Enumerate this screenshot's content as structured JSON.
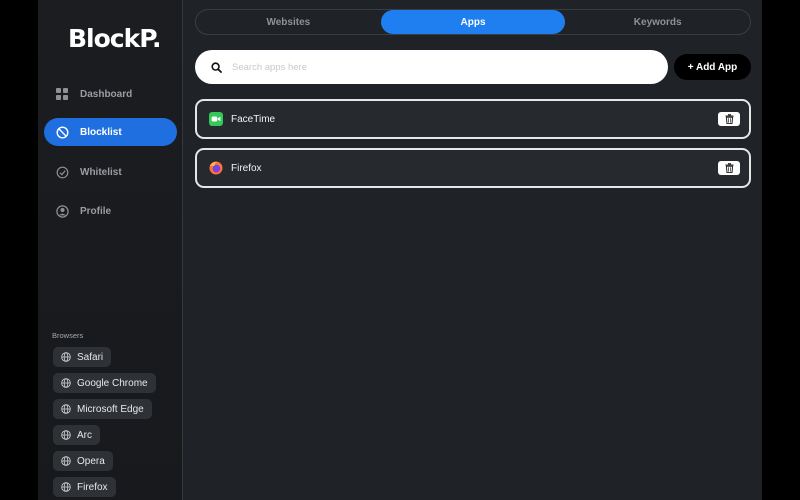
{
  "app": {
    "logo_text": "BlockP."
  },
  "sidebar": {
    "items": [
      {
        "label": "Dashboard",
        "icon": "grid-icon",
        "active": false
      },
      {
        "label": "Blocklist",
        "icon": "block-icon",
        "active": true
      },
      {
        "label": "Whitelist",
        "icon": "check-circle-icon",
        "active": false
      },
      {
        "label": "Profile",
        "icon": "user-circle-icon",
        "active": false
      }
    ],
    "browsers_title": "Browsers",
    "browsers": [
      {
        "label": "Safari",
        "icon": "globe-icon"
      },
      {
        "label": "Google Chrome",
        "icon": "globe-icon"
      },
      {
        "label": "Microsoft Edge",
        "icon": "globe-icon"
      },
      {
        "label": "Arc",
        "icon": "globe-icon"
      },
      {
        "label": "Opera",
        "icon": "globe-icon"
      },
      {
        "label": "Firefox",
        "icon": "globe-icon"
      }
    ]
  },
  "tabs": [
    {
      "label": "Websites",
      "active": false
    },
    {
      "label": "Apps",
      "active": true
    },
    {
      "label": "Keywords",
      "active": false
    }
  ],
  "search": {
    "placeholder": "Search apps here",
    "value": ""
  },
  "add_button": {
    "label": "+ Add App"
  },
  "apps": [
    {
      "name": "FaceTime",
      "icon": "facetime-icon"
    },
    {
      "name": "Firefox",
      "icon": "firefox-icon"
    }
  ],
  "colors": {
    "accent": "#1f7ef0",
    "sidebar_active": "#1f6fe0",
    "background": "#1f2226"
  }
}
